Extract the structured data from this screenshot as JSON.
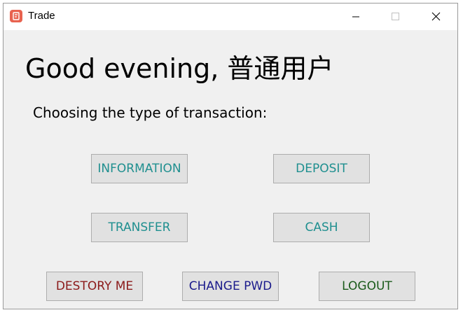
{
  "window": {
    "title": "Trade",
    "icon": "trade-app-icon",
    "controls": [
      "minimize-icon",
      "maximize-icon",
      "close-icon"
    ]
  },
  "main": {
    "greeting": "Good evening, 普通用户",
    "subtitle": "Choosing the type of transaction:"
  },
  "buttons": {
    "information": "INFORMATION",
    "deposit": "DEPOSIT",
    "transfer": "TRANSFER",
    "cash": "CASH",
    "destory": "DESTORY ME",
    "change_pwd": "CHANGE PWD",
    "logout": "LOGOUT"
  },
  "colors": {
    "teal": "#1f8f8f",
    "red": "#8b1a1a",
    "navy": "#1a1a8b",
    "green": "#1a5a1a",
    "button_bg": "#e1e1e1",
    "window_bg": "#f0f0f0",
    "app_icon": "#e8624f"
  }
}
